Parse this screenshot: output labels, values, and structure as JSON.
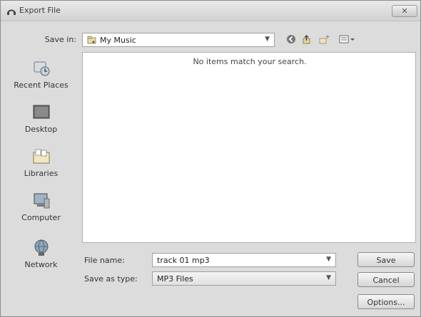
{
  "window": {
    "title": "Export File",
    "close_label": "✕"
  },
  "nav": {
    "save_in_label": "Save in:",
    "location": "My Music",
    "toolbar_icons": [
      "back-icon",
      "up-folder-icon",
      "new-folder-icon",
      "view-menu-icon"
    ]
  },
  "places": [
    {
      "label": "Recent Places",
      "icon": "recent-places-icon"
    },
    {
      "label": "Desktop",
      "icon": "desktop-icon"
    },
    {
      "label": "Libraries",
      "icon": "libraries-icon"
    },
    {
      "label": "Computer",
      "icon": "computer-icon"
    },
    {
      "label": "Network",
      "icon": "network-icon"
    }
  ],
  "file_list": {
    "empty_message": "No items match your search."
  },
  "form": {
    "file_name_label": "File name:",
    "file_name_value": "track 01 mp3",
    "type_label": "Save as type:",
    "type_value": "MP3 Files"
  },
  "buttons": {
    "save": "Save",
    "cancel": "Cancel",
    "options": "Options..."
  },
  "colors": {
    "dialog_bg": "#dcdcdc",
    "list_bg": "#ffffff"
  }
}
